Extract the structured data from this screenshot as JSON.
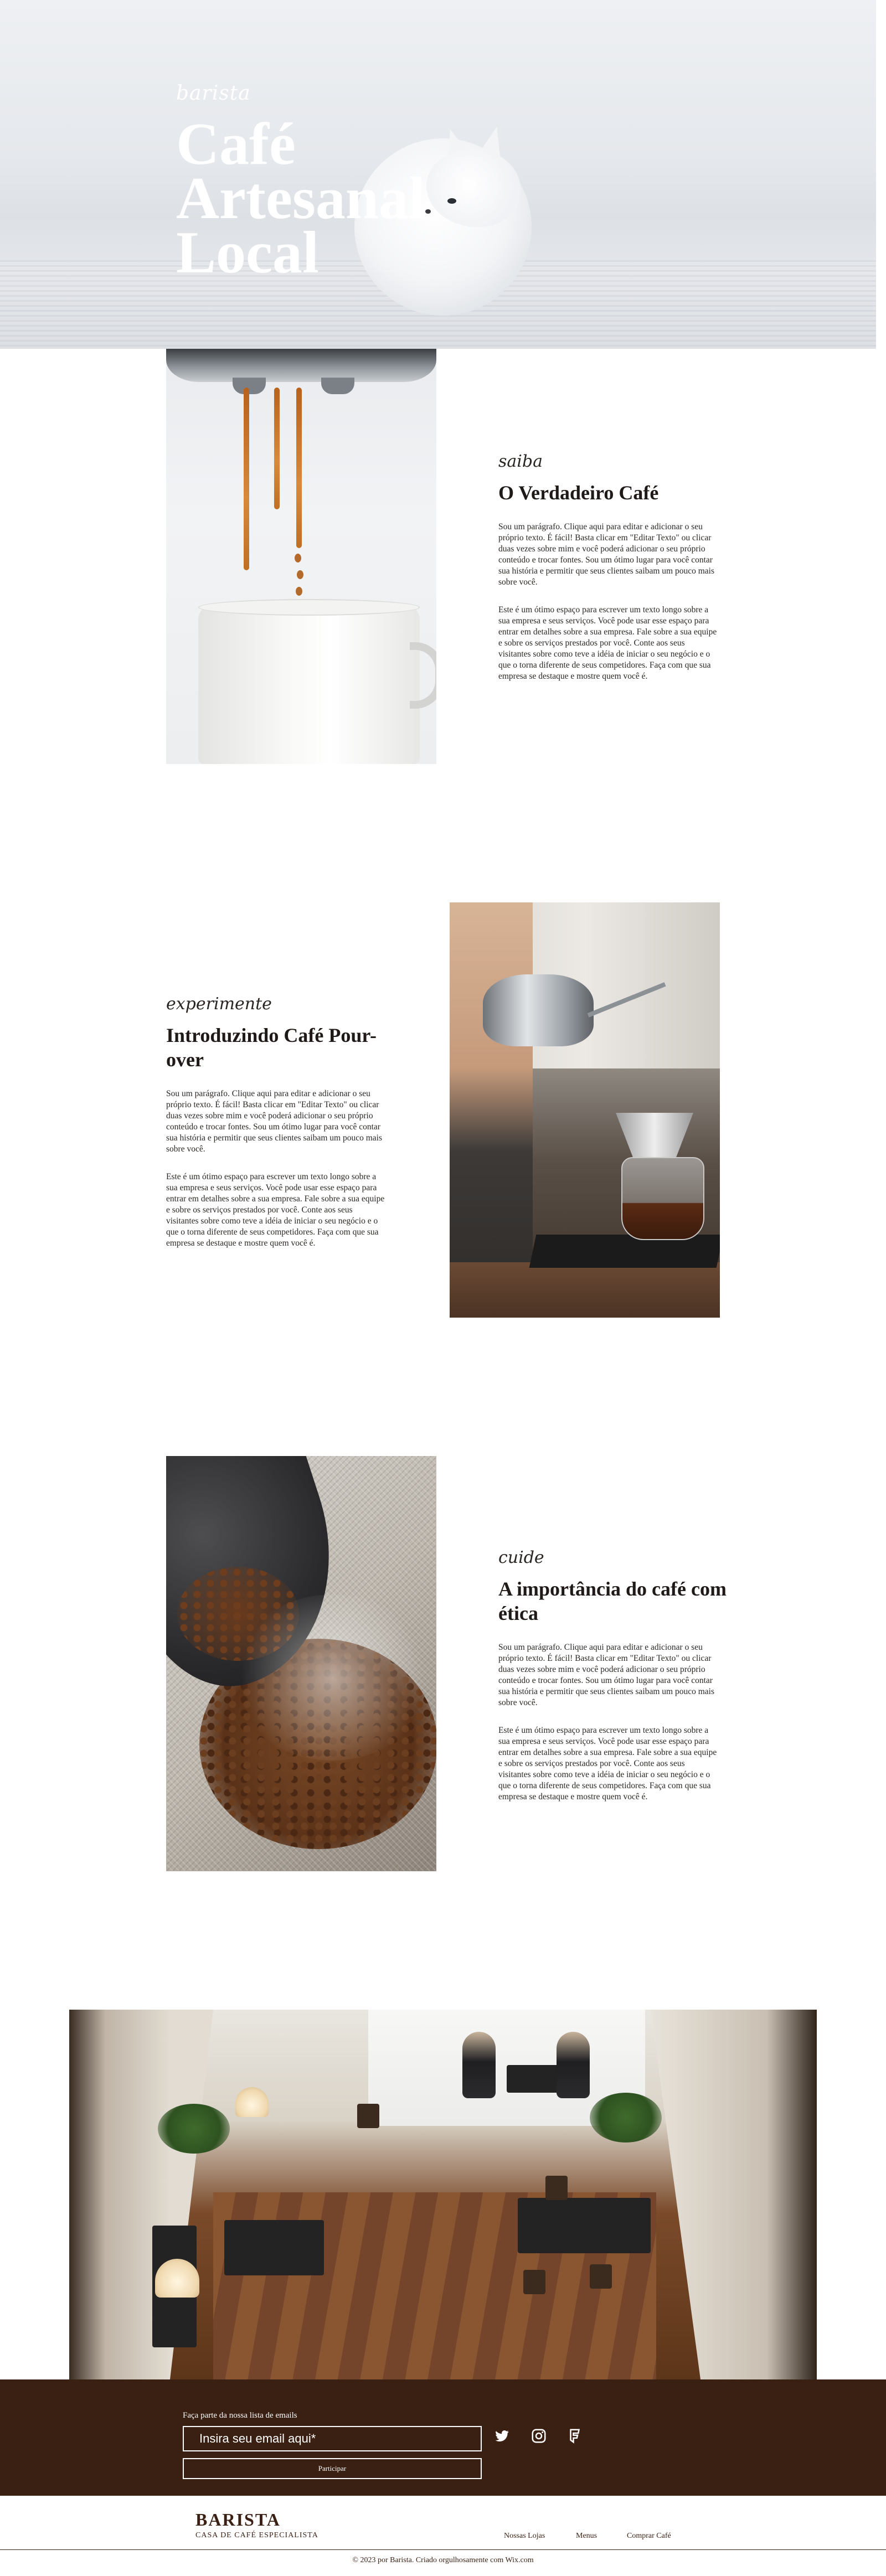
{
  "hero": {
    "subtitle": "barista",
    "title": "Café Artesanal Local"
  },
  "sections": [
    {
      "script": "saiba",
      "heading": "O Verdadeiro Café",
      "p1": "Sou um parágrafo. Clique aqui para editar e adicionar o seu próprio texto. É fácil! Basta clicar em \"Editar Texto\" ou clicar duas vezes sobre mim e você poderá adicionar o seu próprio conteúdo e trocar fontes. Sou um ótimo lugar para você contar sua história e permitir que seus clientes saibam um pouco mais sobre você.",
      "p2": "Este é um ótimo espaço para escrever um texto longo sobre a sua empresa e seus serviços. Você pode usar esse espaço para entrar em detalhes sobre a sua empresa. Fale sobre a sua equipe e sobre os serviços prestados por você. Conte aos seus visitantes sobre como teve a idéia de iniciar o seu negócio e o que o torna diferente de seus competidores. Faça com que sua empresa se destaque e mostre quem você é."
    },
    {
      "script": "experimente",
      "heading": "Introduzindo Café Pour-over",
      "p1": "Sou um parágrafo. Clique aqui para editar e adicionar o seu próprio texto. É fácil! Basta clicar em \"Editar Texto\" ou clicar duas vezes sobre mim e você poderá adicionar o seu próprio conteúdo e trocar fontes. Sou um ótimo lugar para você contar sua história e permitir que seus clientes saibam um pouco mais sobre você.",
      "p2": "Este é um ótimo espaço para escrever um texto longo sobre a sua empresa e seus serviços. Você pode usar esse espaço para entrar em detalhes sobre a sua empresa. Fale sobre a sua equipe e sobre os serviços prestados por você. Conte aos seus visitantes sobre como teve a idéia de iniciar o seu negócio e o que o torna diferente de seus competidores. Faça com que sua empresa se destaque e mostre quem você é."
    },
    {
      "script": "cuide",
      "heading": "A importância do café com ética",
      "p1": "Sou um parágrafo. Clique aqui para editar e adicionar o seu próprio texto. É fácil! Basta clicar em \"Editar Texto\" ou clicar duas vezes sobre mim e você poderá adicionar o seu próprio conteúdo e trocar fontes. Sou um ótimo lugar para você contar sua história e permitir que seus clientes saibam um pouco mais sobre você.",
      "p2": "Este é um ótimo espaço para escrever um texto longo sobre a sua empresa e seus serviços. Você pode usar esse espaço para entrar em detalhes sobre a sua empresa. Fale sobre a sua equipe e sobre os serviços prestados por você. Conte aos seus visitantes sobre como teve a idéia de iniciar o seu negócio e o que o torna diferente de seus competidores. Faça com que sua empresa se destaque e mostre quem você é."
    }
  ],
  "newsletter": {
    "label": "Faça parte da nossa lista de emails",
    "placeholder": "Insira seu email aqui*",
    "button": "Participar"
  },
  "social": [
    "twitter-icon",
    "instagram-icon",
    "foursquare-icon"
  ],
  "footer": {
    "brand": "BARISTA",
    "tagline": "CASA DE CAFÉ ESPECIALISTA",
    "nav": [
      "Nossas Lojas",
      "Menus",
      "Comprar Café"
    ],
    "copyright": "© 2023 por Barista. Criado orgulhosamente com Wix.com"
  },
  "colors": {
    "band": "#3a1f13",
    "text": "#1f1a17",
    "footer_text": "#3a1f13"
  }
}
